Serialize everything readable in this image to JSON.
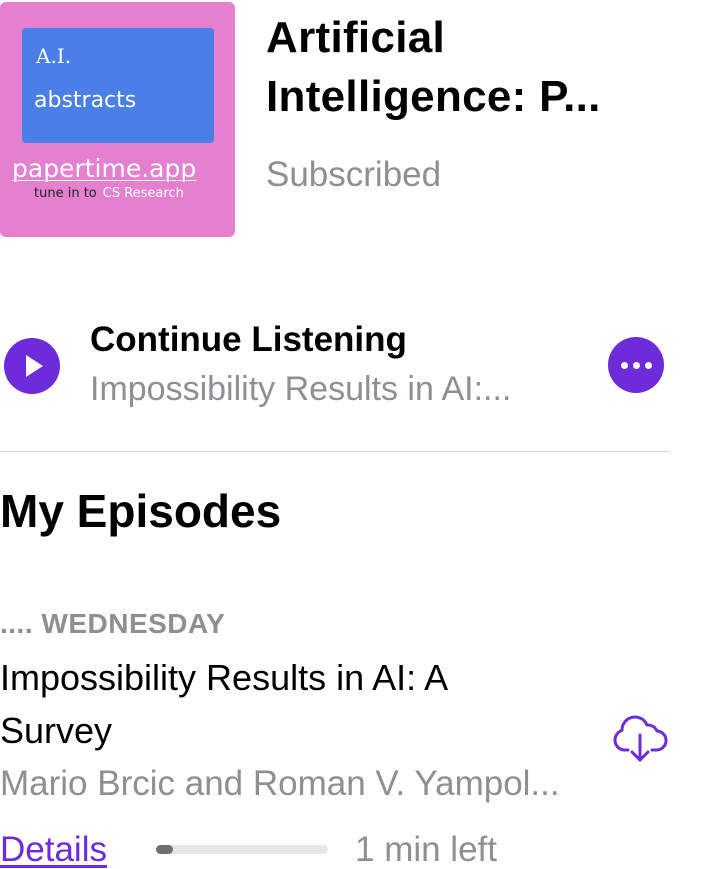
{
  "artwork": {
    "line1": "A.I.",
    "line2": "abstracts",
    "brand": "papertime.app",
    "tune_prefix": "tune in to",
    "tune_highlight": "CS Research",
    "bg_color": "#e57fcf",
    "box_color": "#4b7fe8"
  },
  "podcast": {
    "title": "Artificial Intelligence: P...",
    "status": "Subscribed"
  },
  "continue_listening": {
    "heading": "Continue Listening",
    "episode": "Impossibility Results in AI:...",
    "play_icon": "play-icon",
    "more_icon": "more-icon"
  },
  "section": {
    "title": "My Episodes"
  },
  "episode": {
    "meta_prefix": "....",
    "day": "WEDNESDAY",
    "title": "Impossibility Results in AI: A Survey",
    "authors": "Mario Brcic and Roman V. Yampol...",
    "details_label": "Details",
    "progress_fraction": 0.1,
    "time_left": "1 min left",
    "download_icon": "cloud-download-icon"
  },
  "colors": {
    "accent": "#6e2bd9",
    "secondary_text": "#8e8e93"
  }
}
